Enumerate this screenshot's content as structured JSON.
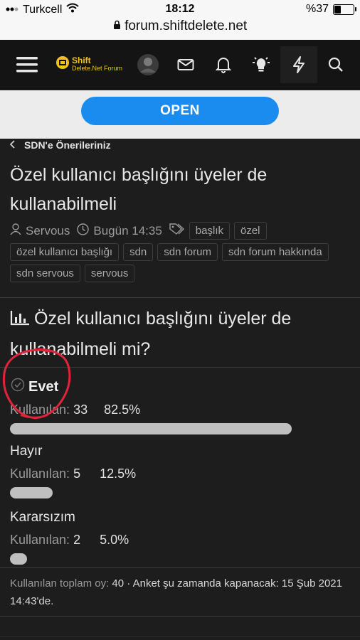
{
  "status_bar": {
    "carrier": "Turkcell",
    "time": "18:12",
    "battery": "%37",
    "battery_level": 0.37,
    "url": "forum.shiftdelete.net"
  },
  "nav": {
    "logo_text_top": "Shift",
    "logo_text_bottom": "Delete.Net Forum",
    "icons": [
      "menu-icon",
      "avatar",
      "mail-icon",
      "bell-icon",
      "lightbulb-icon",
      "bolt-icon",
      "search-icon"
    ]
  },
  "ad": {
    "open_label": "OPEN"
  },
  "breadcrumb": {
    "label": "SDN'e Önerileriniz"
  },
  "thread": {
    "title": "Özel kullanıcı başlığını üyeler de kullanabilmeli",
    "author": "Servous",
    "date": "Bugün 14:35",
    "tags": [
      "başlık",
      "özel",
      "özel kullanıcı başlığı",
      "sdn",
      "sdn forum",
      "sdn forum hakkında",
      "sdn servous",
      "servous"
    ]
  },
  "poll": {
    "question": "Özel kullanıcı başlığını üyeler de kullanabilmeli mi?",
    "used_label": "Kullanılan:",
    "options": [
      {
        "label": "Evet",
        "votes": "33",
        "percent": "82.5%",
        "fraction": 0.825,
        "selected": true
      },
      {
        "label": "Hayır",
        "votes": "5",
        "percent": "12.5%",
        "fraction": 0.125,
        "selected": false
      },
      {
        "label": "Kararsızım",
        "votes": "2",
        "percent": "5.0%",
        "fraction": 0.05,
        "selected": false
      }
    ],
    "footer_total_label": "Kullanılan toplam oy:",
    "footer_total": "40",
    "footer_close_text": "· Anket şu zamanda kapanacak: 15 Şub 2021 14:43'de."
  },
  "colors": {
    "accent": "#1a8cf0",
    "background": "#1d1d1d",
    "annotation": "#e0243a",
    "logo": "#f2c21b"
  }
}
